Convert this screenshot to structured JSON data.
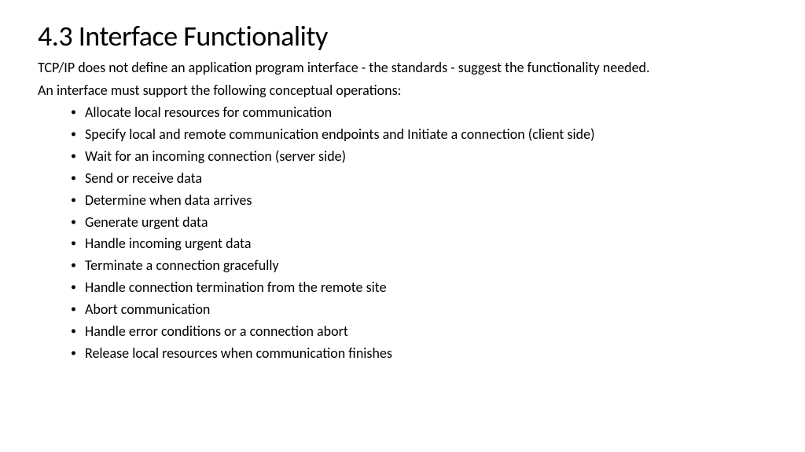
{
  "title": "4.3 Interface Functionality",
  "intro": "TCP/IP does not define an application program interface - the standards - suggest the functionality needed.",
  "subintro": "An interface must support the following conceptual operations:",
  "bullets": [
    "Allocate local resources for communication",
    "Specify local and remote communication endpoints and Initiate a connection (client side)",
    "Wait for an incoming connection (server side)",
    "Send or receive data",
    "Determine when data arrives",
    "Generate urgent data",
    "Handle incoming urgent data",
    "Terminate a connection gracefully",
    "Handle connection termination from the remote site",
    "Abort communication",
    "Handle error conditions or a connection abort",
    "Release local resources when communication finishes"
  ]
}
